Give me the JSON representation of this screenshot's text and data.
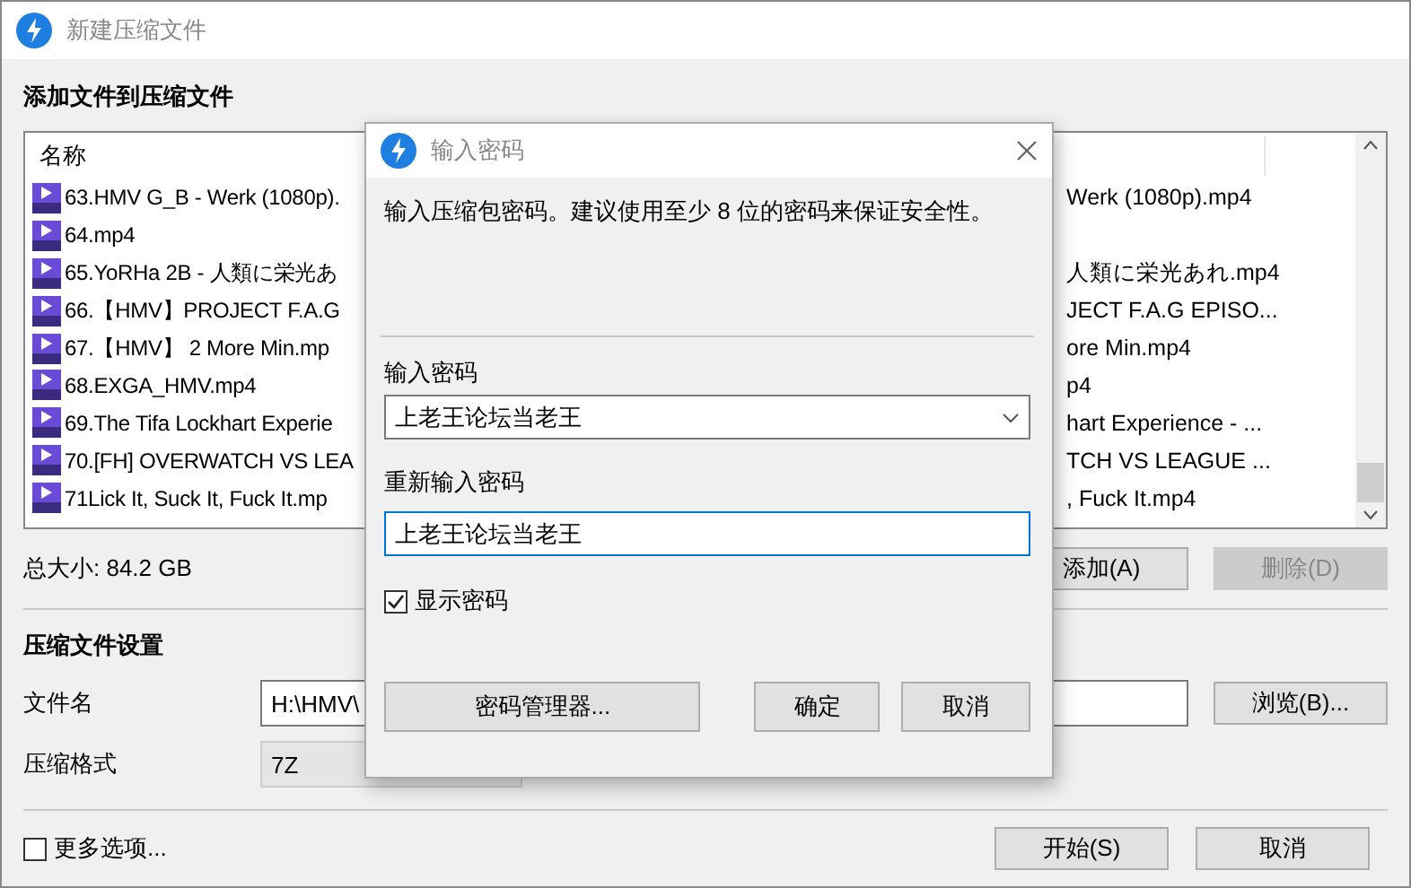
{
  "window": {
    "title": "新建压缩文件"
  },
  "add_section": {
    "heading": "添加文件到压缩文件"
  },
  "file_list": {
    "columns": [
      "名称"
    ],
    "rows": [
      {
        "name": "63.HMV G_B - Werk (1080p).",
        "column_2": "Werk (1080p).mp4"
      },
      {
        "name": "64.mp4"
      },
      {
        "name": "65.YoRHa 2B - 人類に栄光あ",
        "column_2": "人類に栄光あれ.mp4"
      },
      {
        "name": "66.【HMV】PROJECT F.A.G",
        "column_2": "JECT F.A.G EPISO..."
      },
      {
        "name": "67.【HMV】 2 More Min.mp",
        "column_2": "ore Min.mp4"
      },
      {
        "name": "68.EXGA_HMV.mp4",
        "column_2": "p4"
      },
      {
        "name": "69.The Tifa Lockhart Experie",
        "column_2": "hart Experience - ..."
      },
      {
        "name": "70.[FH] OVERWATCH VS LEA",
        "column_2": "TCH VS LEAGUE ..."
      },
      {
        "name": "71Lick It, Suck It, Fuck It.mp",
        "column_2": ", Fuck It.mp4"
      }
    ]
  },
  "total_size": "总大小: 84.2 GB",
  "list_buttons": [
    {
      "label": "添加(A)",
      "disabled": false
    },
    {
      "label": "删除(D)",
      "disabled": true
    }
  ],
  "settings": {
    "heading": "压缩文件设置",
    "filename_label": "文件名",
    "filename_value": "H:\\HMV\\",
    "browse_button": "浏览(B)...",
    "format_label": "压缩格式",
    "format_value": "7Z"
  },
  "more_options": {
    "label": "更多选项...",
    "checked": false
  },
  "footer_buttons": [
    "开始(S)",
    "取消"
  ],
  "dialog": {
    "title": "输入密码",
    "description": "输入压缩包密码。建议使用至少 8 位的密码来保证安全性。",
    "password_label": "输入密码",
    "password_value": "上老王论坛当老王",
    "confirm_label": "重新输入密码",
    "confirm_value": "上老王论坛当老王",
    "show_password": {
      "label": "显示密码",
      "checked": true
    },
    "buttons": [
      "密码管理器...",
      "确定",
      "取消"
    ]
  }
}
